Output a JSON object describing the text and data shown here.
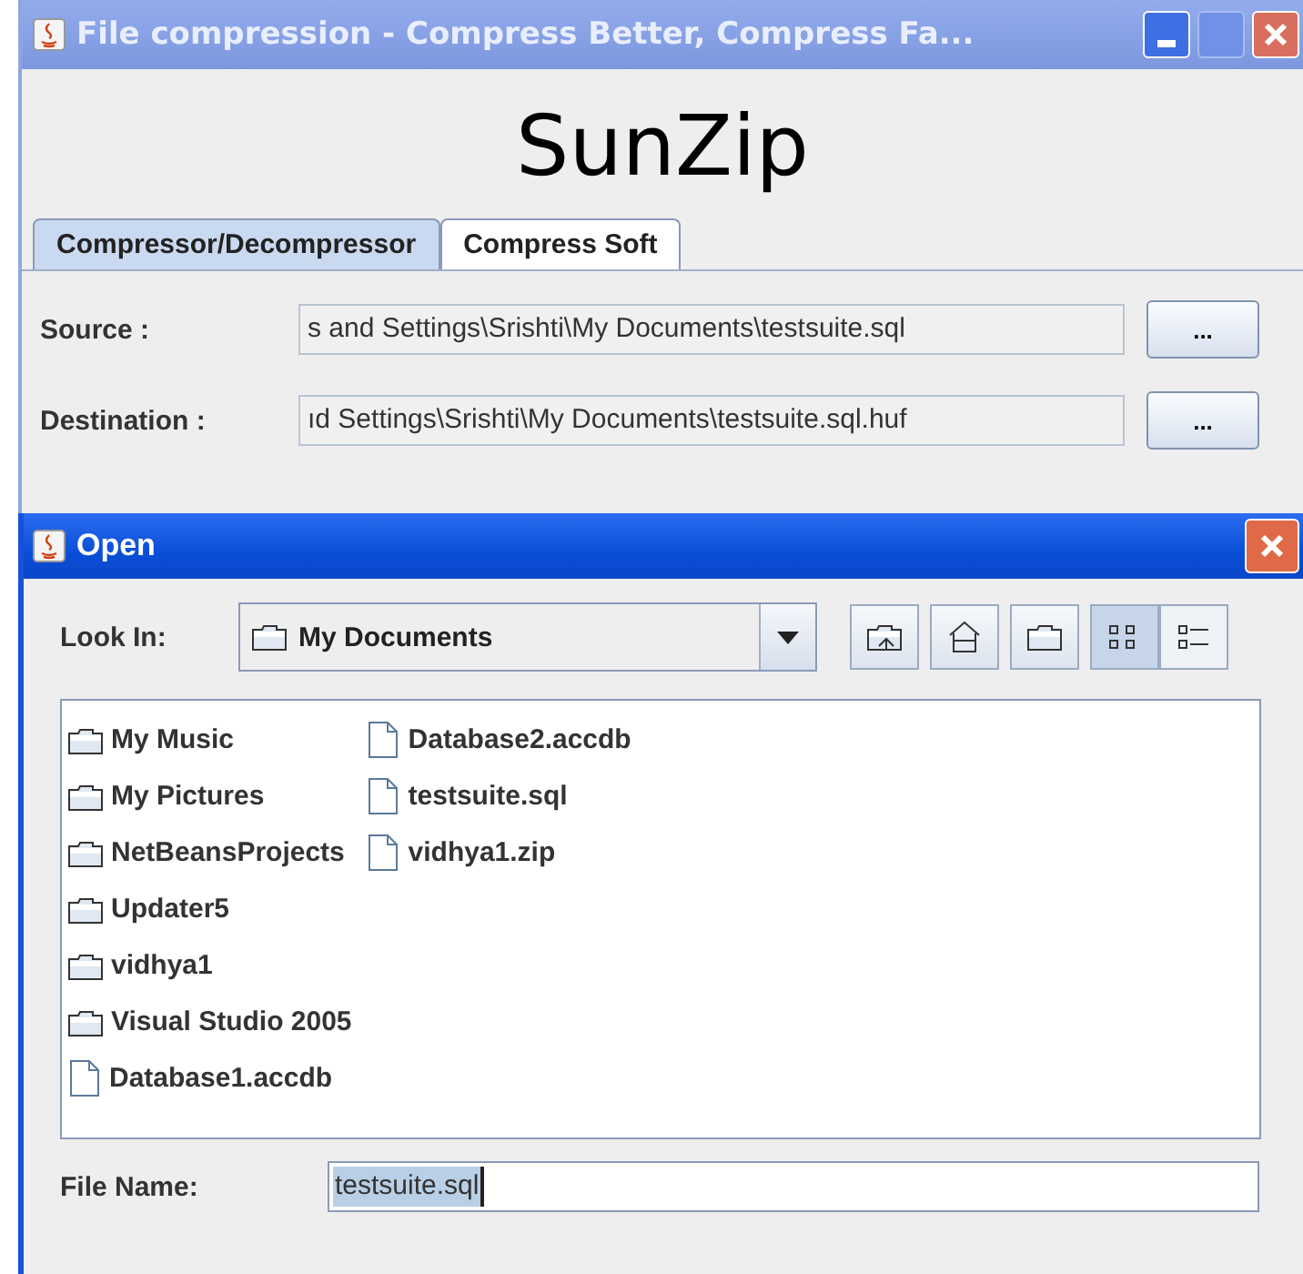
{
  "window": {
    "title": "File compression - Compress Better, Compress Fa..."
  },
  "logo": "SunZip",
  "tabs": [
    {
      "label": "Compressor/Decompressor",
      "selected": true
    },
    {
      "label": "Compress Soft",
      "selected": false
    }
  ],
  "fields": [
    {
      "label": "Source :",
      "value": "s and Settings\\Srishti\\My Documents\\testsuite.sql",
      "button": "..."
    },
    {
      "label": "Destination :",
      "value": "ıd Settings\\Srishti\\My Documents\\testsuite.sql.huf",
      "button": "..."
    }
  ],
  "dialog": {
    "title": "Open",
    "look_in_label": "Look In:",
    "look_in_value": "My Documents",
    "view_buttons": [
      {
        "kind": "list",
        "selected": true
      },
      {
        "kind": "details",
        "selected": false
      }
    ],
    "files": [
      {
        "name": "My Music",
        "kind": "folder"
      },
      {
        "name": "My Pictures",
        "kind": "folder"
      },
      {
        "name": "NetBeansProjects",
        "kind": "folder"
      },
      {
        "name": "Updater5",
        "kind": "folder"
      },
      {
        "name": "vidhya1",
        "kind": "folder"
      },
      {
        "name": "Visual Studio 2005",
        "kind": "folder"
      },
      {
        "name": "Database1.accdb",
        "kind": "file"
      },
      {
        "name": "Database2.accdb",
        "kind": "file"
      },
      {
        "name": "testsuite.sql",
        "kind": "file"
      },
      {
        "name": "vidhya1.zip",
        "kind": "file"
      }
    ],
    "file_name_label": "File Name:",
    "file_name_value": "testsuite.sql",
    "file_name_selected": true
  }
}
